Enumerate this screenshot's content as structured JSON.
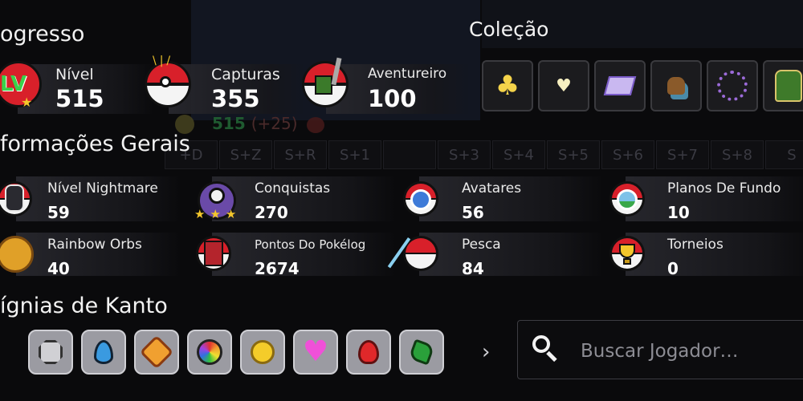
{
  "progress": {
    "title": "ogresso",
    "stats": [
      {
        "label": "Nível",
        "value": "515",
        "icon": "level-lv-icon"
      },
      {
        "label": "Capturas",
        "value": "355",
        "icon": "pokeball-capture-icon"
      },
      {
        "label": "Aventureiro",
        "value": "100",
        "icon": "adventurer-icon"
      }
    ]
  },
  "collection": {
    "title": "Coleção",
    "items": [
      "golden-clover-icon",
      "heart-locket-icon",
      "purple-box-icon",
      "pokemon-sprite-icon",
      "bead-necklace-icon",
      "green-backpack-icon"
    ]
  },
  "background": {
    "ghost_level": "515",
    "ghost_delta": "(+25)",
    "slots": [
      "+D",
      "S+Z",
      "S+R",
      "S+1",
      "",
      "S+3",
      "S+4",
      "S+5",
      "S+6",
      "S+7",
      "S+8",
      "S"
    ]
  },
  "general": {
    "title": "formações Gerais",
    "stats": [
      {
        "label": "Nível Nightmare",
        "value": "59",
        "icon": "nightmare-pokemon-icon"
      },
      {
        "label": "Conquistas",
        "value": "270",
        "icon": "achievements-trophy-icon"
      },
      {
        "label": "Avatares",
        "value": "56",
        "icon": "avatar-wave-icon"
      },
      {
        "label": "Planos De Fundo",
        "value": "10",
        "icon": "background-landscape-icon"
      },
      {
        "label": "Rainbow Orbs",
        "value": "40",
        "icon": "rainbow-orb-icon"
      },
      {
        "label": "Pontos Do Pokélog",
        "value": "2674",
        "icon": "pokelog-book-icon"
      },
      {
        "label": "Pesca",
        "value": "84",
        "icon": "fishing-rod-icon"
      },
      {
        "label": "Torneios",
        "value": "0",
        "icon": "tournament-cup-icon"
      }
    ]
  },
  "badges": {
    "title": "ígnias de Kanto",
    "items": [
      "boulder-badge-icon",
      "cascade-badge-icon",
      "thunder-badge-icon",
      "rainbow-badge-icon",
      "soul-badge-icon",
      "marsh-badge-icon",
      "volcano-badge-icon",
      "earth-badge-icon"
    ]
  },
  "search": {
    "placeholder": "Buscar Jogador…",
    "next_symbol": "›"
  },
  "colors": {
    "accent_red": "#d8202a",
    "background": "#0a0a0c"
  }
}
